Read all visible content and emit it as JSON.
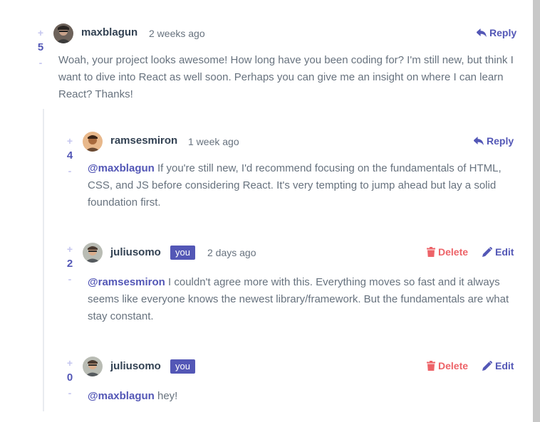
{
  "comments": [
    {
      "username": "maxblagun",
      "timestamp": "2 weeks ago",
      "score": "5",
      "plus": "+",
      "minus": "-",
      "action_reply": "Reply",
      "body": "Woah, your project looks awesome! How long have you been coding for? I'm still new, but think I want to dive into React as well soon. Perhaps you can give me an insight on where I can learn React? Thanks!"
    },
    {
      "username": "ramsesmiron",
      "timestamp": "1 week ago",
      "score": "4",
      "plus": "+",
      "minus": "-",
      "action_reply": "Reply",
      "mention": "@maxblagun",
      "body": "If you're still new, I'd recommend focusing on the fundamentals of HTML, CSS, and JS before considering React. It's very tempting to jump ahead but lay a solid foundation first."
    },
    {
      "username": "juliusomo",
      "badge": "you",
      "timestamp": "2 days ago",
      "score": "2",
      "plus": "+",
      "minus": "-",
      "action_delete": "Delete",
      "action_edit": "Edit",
      "mention": "@ramsesmiron",
      "body": "I couldn't agree more with this. Everything moves so fast and it always seems like everyone knows the newest library/framework. But the fundamentals are what stay constant."
    },
    {
      "username": "juliusomo",
      "badge": "you",
      "timestamp": "",
      "score": "0",
      "plus": "+",
      "minus": "-",
      "action_delete": "Delete",
      "action_edit": "Edit",
      "mention": "@maxblagun",
      "body": "hey!"
    }
  ],
  "colors": {
    "accent": "#5357b6",
    "danger": "#ed6368",
    "text": "#67727e",
    "heading": "#334253",
    "vote_light": "#c5c6ef"
  },
  "icons": {
    "reply": "reply-arrow-icon",
    "delete": "trash-icon",
    "edit": "pencil-icon"
  }
}
